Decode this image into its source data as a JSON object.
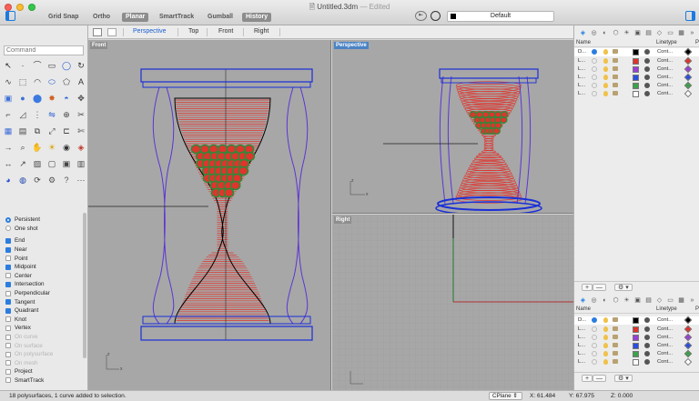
{
  "window": {
    "title": "Untitled.3dm",
    "edited": "— Edited",
    "traffic_colors": [
      "#fc5f57",
      "#fdbc2e",
      "#34c84a"
    ]
  },
  "toolbar": {
    "modes": [
      {
        "label": "Grid Snap",
        "on": false
      },
      {
        "label": "Ortho",
        "on": false
      },
      {
        "label": "Planar",
        "on": true
      },
      {
        "label": "SmartTrack",
        "on": false
      },
      {
        "label": "Gumball",
        "on": false
      },
      {
        "label": "History",
        "on": true
      }
    ],
    "current_layer": "Default",
    "current_layer_color": "#000000"
  },
  "command": {
    "placeholder": "Command"
  },
  "osnaps": {
    "persistent_label": "Persistent",
    "one_shot_label": "One shot",
    "items": [
      {
        "label": "End",
        "checked": true,
        "enabled": true
      },
      {
        "label": "Near",
        "checked": true,
        "enabled": true
      },
      {
        "label": "Point",
        "checked": false,
        "enabled": true
      },
      {
        "label": "Midpoint",
        "checked": true,
        "enabled": true
      },
      {
        "label": "Center",
        "checked": false,
        "enabled": true
      },
      {
        "label": "Intersection",
        "checked": true,
        "enabled": true
      },
      {
        "label": "Perpendicular",
        "checked": false,
        "enabled": true
      },
      {
        "label": "Tangent",
        "checked": true,
        "enabled": true
      },
      {
        "label": "Quadrant",
        "checked": true,
        "enabled": true
      },
      {
        "label": "Knot",
        "checked": false,
        "enabled": true
      },
      {
        "label": "Vertex",
        "checked": false,
        "enabled": true
      },
      {
        "label": "On curve",
        "checked": false,
        "enabled": false
      },
      {
        "label": "On surface",
        "checked": false,
        "enabled": false
      },
      {
        "label": "On polysurface",
        "checked": false,
        "enabled": false
      },
      {
        "label": "On mesh",
        "checked": false,
        "enabled": false
      },
      {
        "label": "Project",
        "checked": false,
        "enabled": true
      },
      {
        "label": "SmartTrack",
        "checked": false,
        "enabled": true
      }
    ]
  },
  "viewport_tabs": [
    "Perspective",
    "Top",
    "Front",
    "Right"
  ],
  "viewports": {
    "front": "Front",
    "perspective": "Perspective",
    "right": "Right"
  },
  "layers_panel": {
    "headers": {
      "name": "Name",
      "linetype": "Linetype",
      "print": "P"
    },
    "rows": [
      {
        "name": "D...",
        "current": true,
        "color": "#000000",
        "linetype": "Cont..."
      },
      {
        "name": "L...",
        "current": false,
        "color": "#e0342c",
        "linetype": "Cont..."
      },
      {
        "name": "L...",
        "current": false,
        "color": "#9a3fd6",
        "linetype": "Cont..."
      },
      {
        "name": "L...",
        "current": false,
        "color": "#2a4fe0",
        "linetype": "Cont..."
      },
      {
        "name": "L...",
        "current": false,
        "color": "#3aa24a",
        "linetype": "Cont..."
      },
      {
        "name": "L...",
        "current": false,
        "color": "#ffffff",
        "linetype": "Cont..."
      }
    ],
    "add_label": "+",
    "remove_label": "—",
    "gear_label": "⚙ ▾"
  },
  "status": {
    "message": "18 polysurfaces, 1 curve added to selection.",
    "cplane": "CPlane",
    "x": "X: 61.484",
    "y": "Y: 67.975",
    "z": "Z: 0.000"
  },
  "axis_labels": {
    "y": "y",
    "x": "x",
    "z": "z"
  },
  "icons": {
    "tools": [
      "select-arrow",
      "point",
      "polyline",
      "rectangle",
      "circle",
      "rotate",
      "curve",
      "select-window",
      "arc",
      "ellipse",
      "polygon",
      "text",
      "box",
      "sphere",
      "cylinder",
      "explode",
      "boolean",
      "move",
      "fillet",
      "chamfer",
      "array",
      "mirror",
      "join",
      "split",
      "grid",
      "layer",
      "copy",
      "scale",
      "offset",
      "trim",
      "extend",
      "zoom",
      "pan",
      "light",
      "render",
      "material",
      "dimension",
      "leader",
      "hatch",
      "group",
      "ungroup",
      "block",
      "sphere-render",
      "globe",
      "history",
      "options",
      "help",
      "other"
    ]
  }
}
